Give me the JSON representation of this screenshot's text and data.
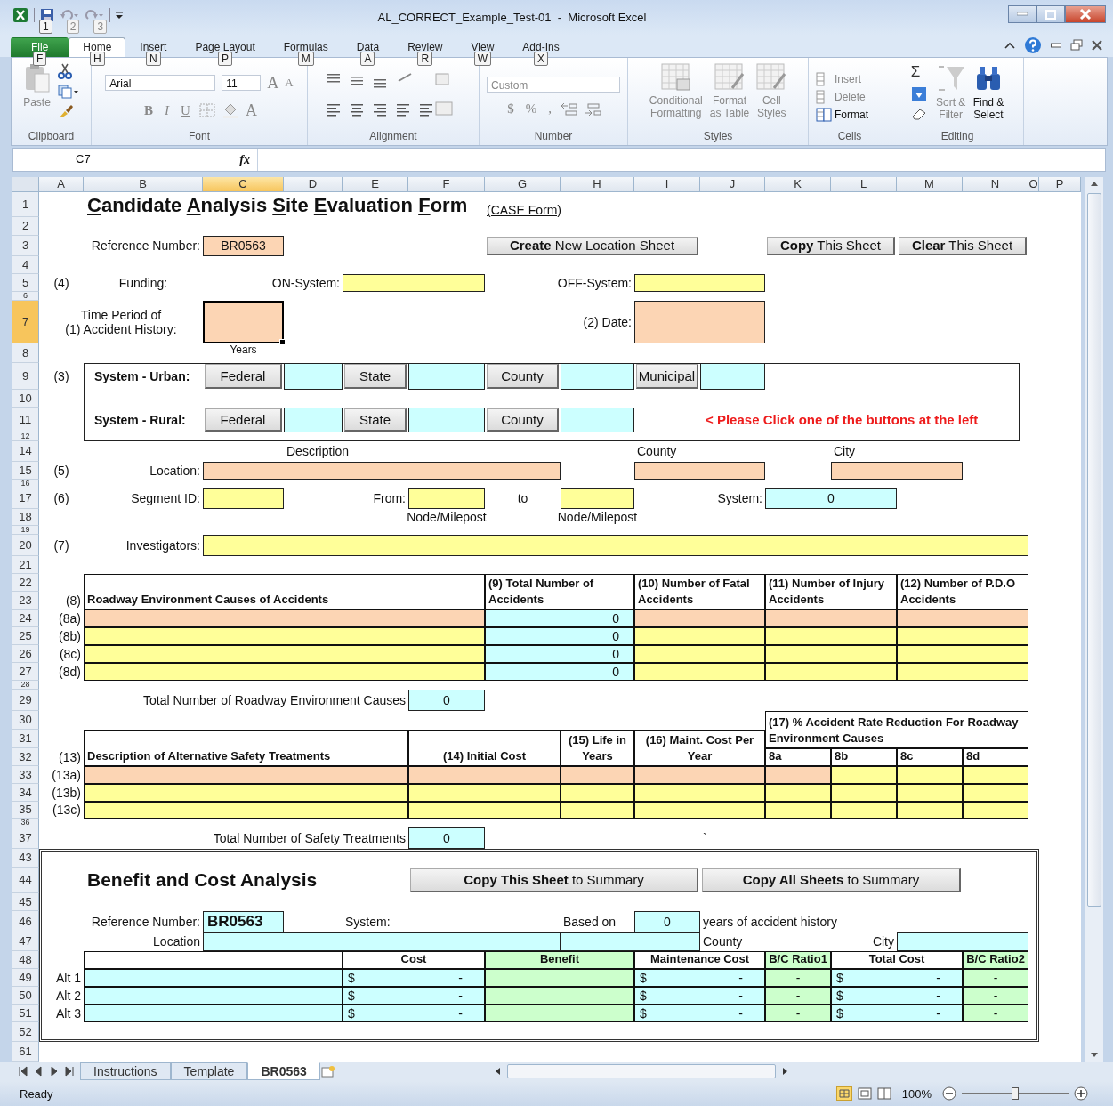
{
  "window": {
    "title": "AL_CORRECT_Example_Test-01  -  Microsoft Excel",
    "quick_access_keytips": [
      "1",
      "2",
      "3"
    ]
  },
  "ribbon_tabs": [
    {
      "label": "File",
      "keytip": "F",
      "selected": false
    },
    {
      "label": "Home",
      "keytip": "H",
      "selected": true
    },
    {
      "label": "Insert",
      "keytip": "N",
      "selected": false
    },
    {
      "label": "Page Layout",
      "keytip": "P",
      "selected": false
    },
    {
      "label": "Formulas",
      "keytip": "M",
      "selected": false
    },
    {
      "label": "Data",
      "keytip": "A",
      "selected": false
    },
    {
      "label": "Review",
      "keytip": "R",
      "selected": false
    },
    {
      "label": "View",
      "keytip": "W",
      "selected": false
    },
    {
      "label": "Add-Ins",
      "keytip": "X",
      "selected": false
    }
  ],
  "ribbon": {
    "groups": [
      "Clipboard",
      "Font",
      "Alignment",
      "Number",
      "Styles",
      "Cells",
      "Editing"
    ],
    "paste": "Paste",
    "font_name": "Arial",
    "font_size": "11",
    "grow_font": "A",
    "shrink_font": "A",
    "font_styles": [
      "B",
      "I",
      "U"
    ],
    "font_color": "A",
    "number_format": "Custom",
    "currency": "$",
    "percent": "%",
    "comma": ",",
    "styles": [
      "Conditional\nFormatting",
      "Format\nas Table",
      "Cell\nStyles"
    ],
    "cells": [
      "Insert",
      "Delete",
      "Format"
    ],
    "autosum": "Σ",
    "editing": [
      "Sort &\nFilter",
      "Find &\nSelect"
    ]
  },
  "formula_bar": {
    "name_box": "C7",
    "function_label": "fx"
  },
  "sheet": {
    "columns": [
      {
        "label": "A",
        "selected": false
      },
      {
        "label": "B",
        "selected": false
      },
      {
        "label": "C",
        "selected": true
      },
      {
        "label": "D",
        "selected": false
      },
      {
        "label": "E",
        "selected": false
      },
      {
        "label": "F",
        "selected": false
      },
      {
        "label": "G",
        "selected": false
      },
      {
        "label": "H",
        "selected": false
      },
      {
        "label": "I",
        "selected": false
      },
      {
        "label": "J",
        "selected": false
      },
      {
        "label": "K",
        "selected": false
      },
      {
        "label": "L",
        "selected": false
      },
      {
        "label": "M",
        "selected": false
      },
      {
        "label": "N",
        "selected": false
      },
      {
        "label": "O",
        "selected": false
      },
      {
        "label": "P",
        "selected": false
      }
    ],
    "rows": [
      {
        "number": "1",
        "selected": false
      },
      {
        "number": "2",
        "selected": false
      },
      {
        "number": "3",
        "selected": false
      },
      {
        "number": "4",
        "selected": false
      },
      {
        "number": "5",
        "selected": false
      },
      {
        "number": "6",
        "selected": false
      },
      {
        "number": "7",
        "selected": true
      },
      {
        "number": "8",
        "selected": false
      },
      {
        "number": "9",
        "selected": false
      },
      {
        "number": "10",
        "selected": false
      },
      {
        "number": "11",
        "selected": false
      },
      {
        "number": "12",
        "selected": false
      },
      {
        "number": "14",
        "selected": false
      },
      {
        "number": "15",
        "selected": false
      },
      {
        "number": "16",
        "selected": false
      },
      {
        "number": "17",
        "selected": false
      },
      {
        "number": "18",
        "selected": false
      },
      {
        "number": "19",
        "selected": false
      },
      {
        "number": "20",
        "selected": false
      },
      {
        "number": "21",
        "selected": false
      },
      {
        "number": "22",
        "selected": false
      },
      {
        "number": "23",
        "selected": false
      },
      {
        "number": "24",
        "selected": false
      },
      {
        "number": "25",
        "selected": false
      },
      {
        "number": "26",
        "selected": false
      },
      {
        "number": "27",
        "selected": false
      },
      {
        "number": "28",
        "selected": false
      },
      {
        "number": "29",
        "selected": false
      },
      {
        "number": "30",
        "selected": false
      },
      {
        "number": "31",
        "selected": false
      },
      {
        "number": "32",
        "selected": false
      },
      {
        "number": "33",
        "selected": false
      },
      {
        "number": "34",
        "selected": false
      },
      {
        "number": "35",
        "selected": false
      },
      {
        "number": "36",
        "selected": false
      },
      {
        "number": "37",
        "selected": false
      },
      {
        "number": "43",
        "selected": false
      },
      {
        "number": "44",
        "selected": false
      },
      {
        "number": "45",
        "selected": false
      },
      {
        "number": "46",
        "selected": false
      },
      {
        "number": "47",
        "selected": false
      },
      {
        "number": "48",
        "selected": false
      },
      {
        "number": "49",
        "selected": false
      },
      {
        "number": "50",
        "selected": false
      },
      {
        "number": "51",
        "selected": false
      },
      {
        "number": "52",
        "selected": false
      },
      {
        "number": "61",
        "selected": false
      }
    ],
    "cells": [
      {
        "kind": "frame"
      },
      {
        "kind": "double"
      },
      {
        "kind": "title",
        "text": "Candidate Analysis Site Evaluation Form"
      },
      {
        "kind": "link",
        "text": "(CASE Form)"
      },
      {
        "kind": "label",
        "text": "Reference Number:"
      },
      {
        "kind": "field",
        "color": "#fcd5b4",
        "text": "BR0563"
      },
      {
        "kind": "button",
        "text": "**Create** New Location Sheet"
      },
      {
        "kind": "button",
        "text": "**Copy** This Sheet"
      },
      {
        "kind": "button",
        "text": "**Clear** This Sheet"
      },
      {
        "kind": "caption",
        "text": "(4)"
      },
      {
        "kind": "caption",
        "text": "Funding:"
      },
      {
        "kind": "label",
        "text": "ON-System:"
      },
      {
        "kind": "field",
        "color": "#ffff99"
      },
      {
        "kind": "label",
        "text": "OFF-System:"
      },
      {
        "kind": "field",
        "color": "#ffff99"
      },
      {
        "kind": "caption",
        "text": "Time Period of\n(1) Accident History:"
      },
      {
        "kind": "field",
        "color": "#fcd5b4",
        "selected": true
      },
      {
        "kind": "small",
        "text": "Years"
      },
      {
        "kind": "label",
        "text": "(2) Date:"
      },
      {
        "kind": "field",
        "color": "#fcd5b4"
      },
      {
        "kind": "caption",
        "text": "(3)"
      },
      {
        "kind": "strong",
        "text": "System - Urban:"
      },
      {
        "kind": "button",
        "text": "Federal"
      },
      {
        "kind": "field",
        "color": "#ccffff"
      },
      {
        "kind": "button",
        "text": "State"
      },
      {
        "kind": "field",
        "color": "#ccffff"
      },
      {
        "kind": "button",
        "text": "County"
      },
      {
        "kind": "field",
        "color": "#ccffff"
      },
      {
        "kind": "button",
        "text": "Municipal"
      },
      {
        "kind": "field",
        "color": "#ccffff"
      },
      {
        "kind": "strong",
        "text": "System - Rural:"
      },
      {
        "kind": "button",
        "text": "Federal"
      },
      {
        "kind": "field",
        "color": "#ccffff"
      },
      {
        "kind": "button",
        "text": "State"
      },
      {
        "kind": "field",
        "color": "#ccffff"
      },
      {
        "kind": "button",
        "text": "County"
      },
      {
        "kind": "field",
        "color": "#ccffff"
      },
      {
        "kind": "warning",
        "text": "< Please Click one of the buttons at the left"
      },
      {
        "kind": "note",
        "text": "Description"
      },
      {
        "kind": "note",
        "text": "County"
      },
      {
        "kind": "note",
        "text": "City"
      },
      {
        "kind": "caption",
        "text": "(5)"
      },
      {
        "kind": "label",
        "text": "Location:"
      },
      {
        "kind": "field",
        "color": "#fcd5b4"
      },
      {
        "kind": "field",
        "color": "#fcd5b4"
      },
      {
        "kind": "field",
        "color": "#fcd5b4"
      },
      {
        "kind": "caption",
        "text": "(6)"
      },
      {
        "kind": "label",
        "text": "Segment ID:"
      },
      {
        "kind": "field",
        "color": "#ffff99"
      },
      {
        "kind": "label",
        "text": "From:"
      },
      {
        "kind": "field",
        "color": "#ffff99"
      },
      {
        "kind": "caption",
        "text": "to"
      },
      {
        "kind": "field",
        "color": "#ffff99"
      },
      {
        "kind": "label",
        "text": "System:"
      },
      {
        "kind": "field",
        "color": "#ccffff",
        "text": "0"
      },
      {
        "kind": "caption",
        "text": "Node/Milepost"
      },
      {
        "kind": "caption",
        "text": "Node/Milepost"
      },
      {
        "kind": "caption",
        "text": "(7)"
      },
      {
        "kind": "label",
        "text": "Investigators:"
      },
      {
        "kind": "field",
        "color": "#ffff99"
      },
      {
        "kind": "label",
        "text": "(8)"
      },
      {
        "kind": "header",
        "text": "Roadway Environment Causes of Accidents"
      },
      {
        "kind": "header",
        "text": "(9) Total Number of Accidents"
      },
      {
        "kind": "header",
        "text": "(10) Number of Fatal Accidents"
      },
      {
        "kind": "header",
        "text": "(11) Number of Injury Accidents"
      },
      {
        "kind": "header",
        "text": "(12) Number of P.D.O Accidents"
      },
      {
        "kind": "label",
        "text": "(8a)"
      },
      {
        "kind": "cell",
        "color": "#fcd5b4"
      },
      {
        "kind": "number",
        "color": "#ccffff",
        "text": "0"
      },
      {
        "kind": "cell",
        "color": "#fcd5b4"
      },
      {
        "kind": "cell",
        "color": "#fcd5b4"
      },
      {
        "kind": "cell",
        "color": "#fcd5b4"
      },
      {
        "kind": "label",
        "text": "(8b)"
      },
      {
        "kind": "cell",
        "color": "#ffff99"
      },
      {
        "kind": "number",
        "color": "#ccffff",
        "text": "0"
      },
      {
        "kind": "cell",
        "color": "#ffff99"
      },
      {
        "kind": "cell",
        "color": "#ffff99"
      },
      {
        "kind": "cell",
        "color": "#ffff99"
      },
      {
        "kind": "label",
        "text": "(8c)"
      },
      {
        "kind": "cell",
        "color": "#ffff99"
      },
      {
        "kind": "number",
        "color": "#ccffff",
        "text": "0"
      },
      {
        "kind": "cell",
        "color": "#ffff99"
      },
      {
        "kind": "cell",
        "color": "#ffff99"
      },
      {
        "kind": "cell",
        "color": "#ffff99"
      },
      {
        "kind": "label",
        "text": "(8d)"
      },
      {
        "kind": "cell",
        "color": "#ffff99"
      },
      {
        "kind": "number",
        "color": "#ccffff",
        "text": "0"
      },
      {
        "kind": "cell",
        "color": "#ffff99"
      },
      {
        "kind": "cell",
        "color": "#ffff99"
      },
      {
        "kind": "cell",
        "color": "#ffff99"
      },
      {
        "kind": "label",
        "text": "Total Number of Roadway Environment Causes"
      },
      {
        "kind": "field",
        "color": "#ccffff",
        "text": "0"
      },
      {
        "kind": "header",
        "text": "(17) % Accident Rate Reduction For Roadway Environment Causes"
      },
      {
        "kind": "label",
        "text": "(13)"
      },
      {
        "kind": "header",
        "text": "Description of Alternative Safety Treatments"
      },
      {
        "kind": "headcenter",
        "text": "(14) Initial Cost"
      },
      {
        "kind": "headcenter",
        "text": "(15) Life in Years"
      },
      {
        "kind": "headcenter",
        "text": "(16) Maint. Cost Per Year"
      },
      {
        "kind": "header",
        "text": "8a"
      },
      {
        "kind": "header",
        "text": "8b"
      },
      {
        "kind": "header",
        "text": "8c"
      },
      {
        "kind": "header",
        "text": "8d"
      },
      {
        "kind": "label",
        "text": "(13a)"
      },
      {
        "kind": "cell",
        "color": "#fcd5b4"
      },
      {
        "kind": "cell",
        "color": "#fcd5b4"
      },
      {
        "kind": "cell",
        "color": "#fcd5b4"
      },
      {
        "kind": "cell",
        "color": "#fcd5b4"
      },
      {
        "kind": "cell",
        "color": "#fcd5b4"
      },
      {
        "kind": "cell",
        "color": "#ffff99"
      },
      {
        "kind": "cell",
        "color": "#ffff99"
      },
      {
        "kind": "cell",
        "color": "#ffff99"
      },
      {
        "kind": "label",
        "text": "(13b)"
      },
      {
        "kind": "cell",
        "color": "#ffff99"
      },
      {
        "kind": "cell",
        "color": "#ffff99"
      },
      {
        "kind": "cell",
        "color": "#ffff99"
      },
      {
        "kind": "cell",
        "color": "#ffff99"
      },
      {
        "kind": "cell",
        "color": "#ffff99"
      },
      {
        "kind": "cell",
        "color": "#ffff99"
      },
      {
        "kind": "cell",
        "color": "#ffff99"
      },
      {
        "kind": "cell",
        "color": "#ffff99"
      },
      {
        "kind": "label",
        "text": "(13c)"
      },
      {
        "kind": "cell",
        "color": "#ffff99"
      },
      {
        "kind": "cell",
        "color": "#ffff99"
      },
      {
        "kind": "cell",
        "color": "#ffff99"
      },
      {
        "kind": "cell",
        "color": "#ffff99"
      },
      {
        "kind": "cell",
        "color": "#ffff99"
      },
      {
        "kind": "cell",
        "color": "#ffff99"
      },
      {
        "kind": "cell",
        "color": "#ffff99"
      },
      {
        "kind": "cell",
        "color": "#ffff99"
      },
      {
        "kind": "label",
        "text": "Total Number of Safety Treatments"
      },
      {
        "kind": "field",
        "color": "#ccffff",
        "text": "0"
      },
      {
        "kind": "note",
        "text": "`"
      },
      {
        "kind": "subtitle",
        "text": "Benefit and Cost Analysis"
      },
      {
        "kind": "button",
        "text": "**Copy  This Sheet** to Summary"
      },
      {
        "kind": "button",
        "text": "**Copy  All  Sheets** to Summary"
      },
      {
        "kind": "label",
        "text": "Reference Number:"
      },
      {
        "kind": "strongfield",
        "color": "#ccffff",
        "text": "BR0563"
      },
      {
        "kind": "note",
        "text": "System:"
      },
      {
        "kind": "note",
        "text": "Based on"
      },
      {
        "kind": "field",
        "color": "#ccffff",
        "text": "0"
      },
      {
        "kind": "note",
        "text": "years of accident history"
      },
      {
        "kind": "label",
        "text": "Location"
      },
      {
        "kind": "field",
        "color": "#ccffff"
      },
      {
        "kind": "field",
        "color": "#ccffff"
      },
      {
        "kind": "note",
        "text": "County"
      },
      {
        "kind": "label",
        "text": "City"
      },
      {
        "kind": "field",
        "color": "#ccffff"
      },
      {
        "kind": "headcenter"
      },
      {
        "kind": "headcenter",
        "text": "Cost"
      },
      {
        "kind": "headcenter",
        "color": "#ccffcc",
        "text": "Benefit"
      },
      {
        "kind": "headcenter",
        "text": "Maintenance Cost"
      },
      {
        "kind": "headcenter",
        "color": "#ccffcc",
        "text": "B/C Ratio1"
      },
      {
        "kind": "headcenter",
        "text": "Total Cost"
      },
      {
        "kind": "headcenter",
        "color": "#ccffcc",
        "text": "B/C Ratio2"
      },
      {
        "kind": "label",
        "text": "Alt 1"
      },
      {
        "kind": "cell",
        "color": "#ccffff"
      },
      {
        "kind": "money",
        "color": "#ccffff",
        "prefix": "$",
        "text": "-"
      },
      {
        "kind": "cell",
        "color": "#ccffcc"
      },
      {
        "kind": "money",
        "color": "#ccffff",
        "prefix": "$",
        "text": "-"
      },
      {
        "kind": "center",
        "color": "#ccffcc",
        "text": "-"
      },
      {
        "kind": "money",
        "color": "#ccffff",
        "prefix": "$",
        "text": "-"
      },
      {
        "kind": "center",
        "color": "#ccffcc",
        "text": "-"
      },
      {
        "kind": "label",
        "text": "Alt 2"
      },
      {
        "kind": "cell",
        "color": "#ccffff"
      },
      {
        "kind": "money",
        "color": "#ccffff",
        "prefix": "$",
        "text": "-"
      },
      {
        "kind": "cell",
        "color": "#ccffcc"
      },
      {
        "kind": "money",
        "color": "#ccffff",
        "prefix": "$",
        "text": "-"
      },
      {
        "kind": "center",
        "color": "#ccffcc",
        "text": "-"
      },
      {
        "kind": "money",
        "color": "#ccffff",
        "prefix": "$",
        "text": "-"
      },
      {
        "kind": "center",
        "color": "#ccffcc",
        "text": "-"
      },
      {
        "kind": "label",
        "text": "Alt 3"
      },
      {
        "kind": "cell",
        "color": "#ccffff"
      },
      {
        "kind": "money",
        "color": "#ccffff",
        "prefix": "$",
        "text": "-"
      },
      {
        "kind": "cell",
        "color": "#ccffcc"
      },
      {
        "kind": "money",
        "color": "#ccffff",
        "prefix": "$",
        "text": "-"
      },
      {
        "kind": "center",
        "color": "#ccffcc",
        "text": "-"
      },
      {
        "kind": "money",
        "color": "#ccffff",
        "prefix": "$",
        "text": "-"
      },
      {
        "kind": "center",
        "color": "#ccffcc",
        "text": "-"
      }
    ]
  },
  "sheet_tabs": [
    {
      "label": "Instructions",
      "selected": false
    },
    {
      "label": "Template",
      "selected": false
    },
    {
      "label": "BR0563",
      "selected": true
    }
  ],
  "status_bar": {
    "text": "Ready",
    "zoom": "100%",
    "zoom_slider": {
      "level": 0.5
    }
  }
}
